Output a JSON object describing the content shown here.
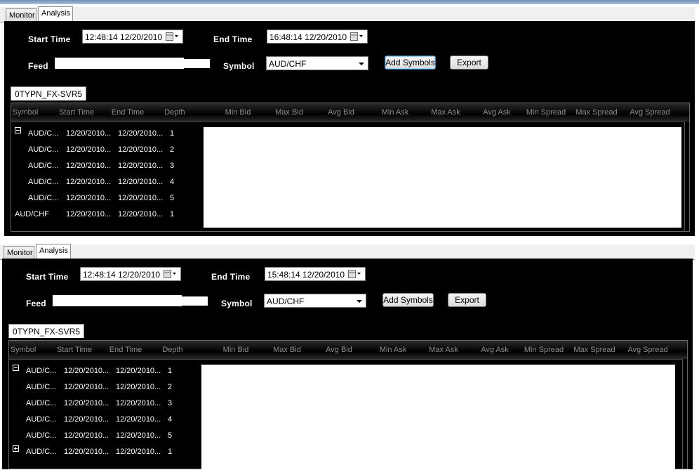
{
  "panels": [
    {
      "tabs": {
        "monitor": "Monitor",
        "analysis": "Analysis"
      },
      "start_time_label": "Start Time",
      "start_time_value": "12:48:14 12/20/2010",
      "end_time_label": "End Time",
      "end_time_value": "16:48:14 12/20/2010",
      "feed_label": "Feed",
      "symbol_label": "Symbol",
      "symbol_value": "AUD/CHF",
      "add_symbols_label": "Add Symbols",
      "export_label": "Export",
      "grid_tab": "0TYPN_FX-SVR5",
      "columns": [
        "Symbol",
        "Start Time",
        "End Time",
        "Depth",
        "Min Bid",
        "Max Bid",
        "Avg Bid",
        "Min Ask",
        "Max Ask",
        "Avg Ask",
        "Min Spread",
        "Max Spread",
        "Avg Spread"
      ],
      "rows": [
        {
          "expander": "minus",
          "symbol": "AUD/C...",
          "start": "12/20/2010...",
          "end": "12/20/2010...",
          "depth": "1"
        },
        {
          "expander": "",
          "symbol": "AUD/C...",
          "start": "12/20/2010...",
          "end": "12/20/2010...",
          "depth": "2"
        },
        {
          "expander": "",
          "symbol": "AUD/C...",
          "start": "12/20/2010...",
          "end": "12/20/2010...",
          "depth": "3"
        },
        {
          "expander": "",
          "symbol": "AUD/C...",
          "start": "12/20/2010...",
          "end": "12/20/2010...",
          "depth": "4"
        },
        {
          "expander": "",
          "symbol": "AUD/C...",
          "start": "12/20/2010...",
          "end": "12/20/2010...",
          "depth": "5"
        },
        {
          "expander": "none",
          "symbol": "AUD/CHF",
          "start": "12/20/2010...",
          "end": "12/20/2010...",
          "depth": "1"
        }
      ]
    },
    {
      "tabs": {
        "monitor": "Monitor",
        "analysis": "Analysis"
      },
      "start_time_label": "Start Time",
      "start_time_value": "12:48:14 12/20/2010",
      "end_time_label": "End Time",
      "end_time_value": "15:48:14 12/20/2010",
      "feed_label": "Feed",
      "symbol_label": "Symbol",
      "symbol_value": "AUD/CHF",
      "add_symbols_label": "Add Symbols",
      "export_label": "Export",
      "grid_tab": "0TYPN_FX-SVR5",
      "columns": [
        "Symbol",
        "Start Time",
        "End Time",
        "Depth",
        "Min Bid",
        "Max Bid",
        "Avg Bid",
        "Min Ask",
        "Max Ask",
        "Avg Ask",
        "Min Spread",
        "Max Spread",
        "Avg Spread"
      ],
      "rows": [
        {
          "expander": "minus",
          "symbol": "AUD/C...",
          "start": "12/20/2010...",
          "end": "12/20/2010...",
          "depth": "1"
        },
        {
          "expander": "",
          "symbol": "AUD/C...",
          "start": "12/20/2010...",
          "end": "12/20/2010...",
          "depth": "2"
        },
        {
          "expander": "",
          "symbol": "AUD/C...",
          "start": "12/20/2010...",
          "end": "12/20/2010...",
          "depth": "3"
        },
        {
          "expander": "",
          "symbol": "AUD/C...",
          "start": "12/20/2010...",
          "end": "12/20/2010...",
          "depth": "4"
        },
        {
          "expander": "",
          "symbol": "AUD/C...",
          "start": "12/20/2010...",
          "end": "12/20/2010...",
          "depth": "5"
        },
        {
          "expander": "plus",
          "symbol": "AUD/C...",
          "start": "12/20/2010...",
          "end": "12/20/2010...",
          "depth": "1"
        }
      ]
    }
  ]
}
